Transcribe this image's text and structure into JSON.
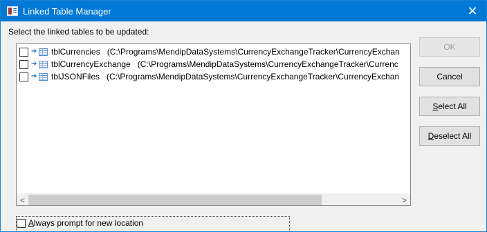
{
  "window": {
    "title": "Linked Table Manager",
    "close_glyph": "✕",
    "app_icon": "linked-table-manager-icon"
  },
  "prompt": "Select the linked tables to be updated:",
  "tables": [
    {
      "checked": false,
      "name": "tblCurrencies",
      "path": "(C:\\Programs\\MendipDataSystems\\CurrencyExchangeTracker\\CurrencyExchan"
    },
    {
      "checked": false,
      "name": "tblCurrencyExchange",
      "path": "(C:\\Programs\\MendipDataSystems\\CurrencyExchangeTracker\\Currenc"
    },
    {
      "checked": false,
      "name": "tblJSONFiles",
      "path": "(C:\\Programs\\MendipDataSystems\\CurrencyExchangeTracker\\CurrencyExchan"
    }
  ],
  "scrollbar": {
    "left_glyph": "<",
    "right_glyph": ">"
  },
  "buttons": {
    "ok": "OK",
    "cancel": "Cancel",
    "select_all_accel": "S",
    "select_all_rest": "elect All",
    "deselect_all_accel": "D",
    "deselect_all_rest": "eselect All"
  },
  "always_prompt": {
    "checked": false,
    "accel": "A",
    "rest": "lways prompt for new location"
  }
}
